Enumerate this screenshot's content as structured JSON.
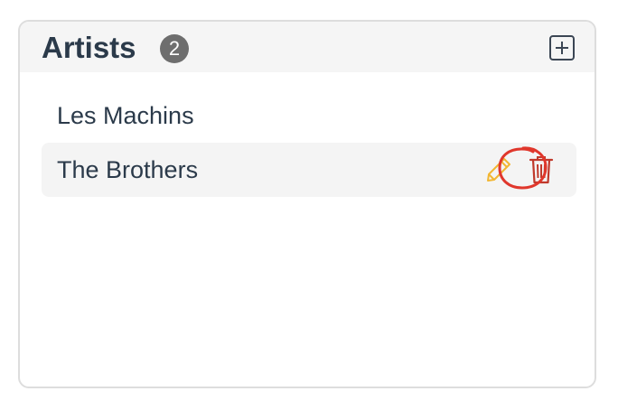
{
  "panel": {
    "title": "Artists",
    "count": "2",
    "add_icon": "plus-square-icon"
  },
  "artists": [
    {
      "name": "Les Machins"
    },
    {
      "name": "The Brothers",
      "edit_icon": "pencil-icon",
      "delete_icon": "trash-icon"
    }
  ],
  "colors": {
    "title": "#2b3a4a",
    "badge": "#6e6e6e",
    "edit": "#f2b632",
    "delete": "#c0392b",
    "annotation": "#e0372c"
  }
}
